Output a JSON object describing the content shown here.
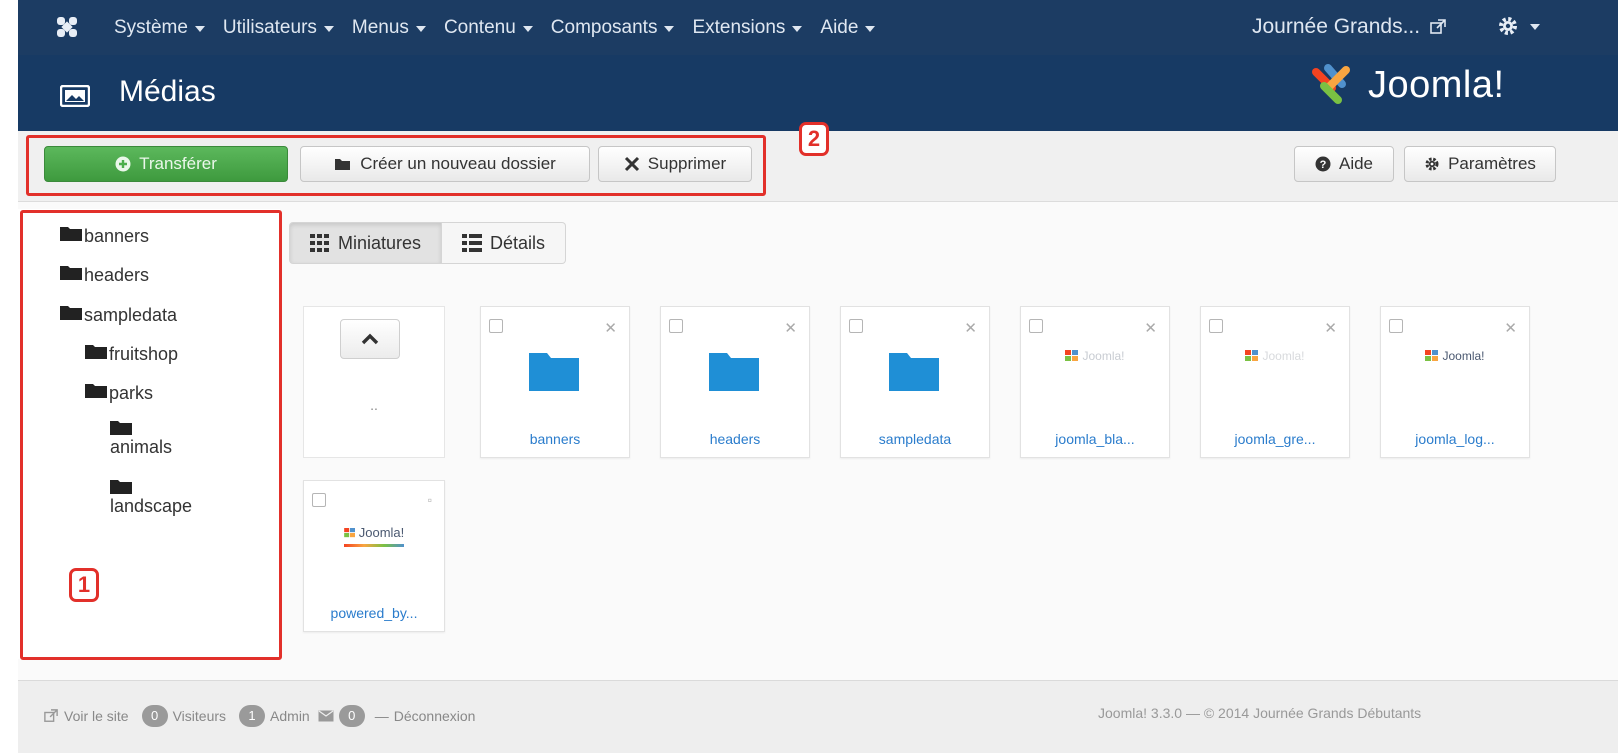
{
  "nav": {
    "menus": [
      "Système",
      "Utilisateurs",
      "Menus",
      "Contenu",
      "Composants",
      "Extensions",
      "Aide"
    ],
    "site_name": "Journée Grands...",
    "icons": {
      "brand": "joomla-icon",
      "external": "external-link-icon",
      "settings": "gear-icon"
    }
  },
  "header": {
    "title": "Médias",
    "logo_text": "Joomla!"
  },
  "toolbar": {
    "upload_label": "Transférer",
    "new_folder_label": "Créer un nouveau dossier",
    "delete_label": "Supprimer",
    "help_label": "Aide",
    "options_label": "Paramètres"
  },
  "callouts": {
    "tree": "1",
    "toolbar": "2"
  },
  "tree": {
    "items": [
      "banners",
      "headers",
      "sampledata",
      "fruitshop",
      "parks",
      "animals",
      "landscape"
    ]
  },
  "view": {
    "thumbnails_label": "Miniatures",
    "details_label": "Détails"
  },
  "files": {
    "up_label": "..",
    "items": [
      {
        "name": "banners",
        "type": "folder"
      },
      {
        "name": "headers",
        "type": "folder"
      },
      {
        "name": "sampledata",
        "type": "folder"
      },
      {
        "name": "joomla_bla...",
        "type": "image"
      },
      {
        "name": "joomla_gre...",
        "type": "image"
      },
      {
        "name": "joomla_log...",
        "type": "image"
      },
      {
        "name": "powered_by...",
        "type": "image"
      }
    ],
    "logo_text": "Joomla!"
  },
  "footer": {
    "view_site": "Voir le site",
    "visitors_count": "0",
    "visitors_label": "Visiteurs",
    "admin_count": "1",
    "admin_label": "Admin",
    "messages_count": "0",
    "logout_label": "Déconnexion",
    "copyright": "Joomla! 3.3.0 — © 2014 Journée Grands Débutants"
  },
  "colors": {
    "nav_bg": "#1c3c63",
    "header_bg": "#173a64",
    "upload_green": "#4cae4c",
    "callout_red": "#e2302a",
    "link_blue": "#2a7ccc",
    "folder_blue": "#1f8fd6"
  }
}
